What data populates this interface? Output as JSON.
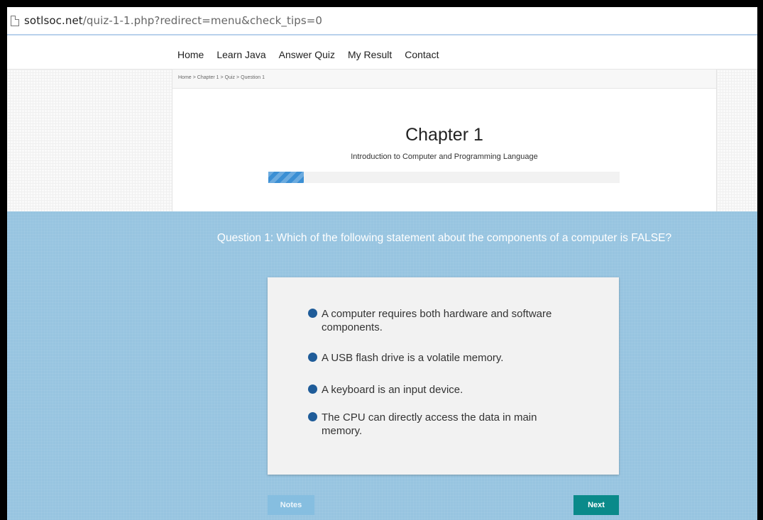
{
  "browser": {
    "url_domain": "sotlsoc.net",
    "url_path": "/quiz-1-1.php?redirect=menu&check_tips=0"
  },
  "nav": {
    "items": [
      "Home",
      "Learn Java",
      "Answer Quiz",
      "My Result",
      "Contact"
    ]
  },
  "breadcrumb": {
    "items": [
      "Home",
      "Chapter 1",
      "Quiz",
      "Question 1"
    ],
    "separator": ">"
  },
  "chapter": {
    "title": "Chapter 1",
    "subtitle": "Introduction to Computer and Programming Language",
    "progress_fraction": 0.1
  },
  "question": {
    "text": "Question 1: Which of the following statement about the components of a computer is FALSE?",
    "options": [
      "A computer requires both hardware and software components.",
      "A USB flash drive is a volatile memory.",
      "A keyboard is an input device.",
      "The CPU can directly access the data in main memory."
    ]
  },
  "buttons": {
    "notes": "Notes",
    "next": "Next"
  },
  "colors": {
    "question_bg": "#97c4e0",
    "option_dot": "#1f5c99",
    "next_button": "#0a8a8a",
    "notes_button": "#86bee0",
    "progress": "#3b8fd4"
  }
}
